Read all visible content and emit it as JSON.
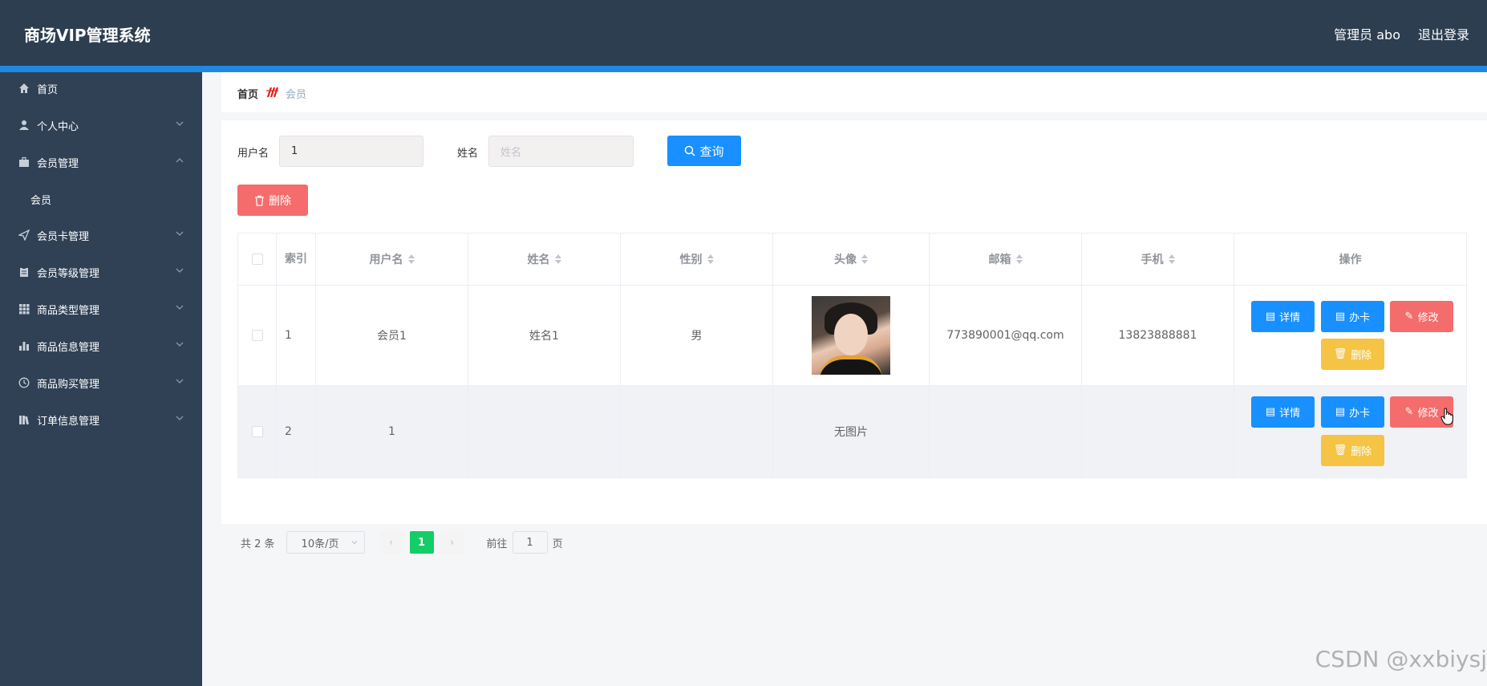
{
  "header": {
    "title": "商场VIP管理系统",
    "user": "管理员 abo",
    "logout": "退出登录"
  },
  "sidebar": {
    "items": [
      {
        "label": "首页",
        "icon": "home-icon"
      },
      {
        "label": "个人中心",
        "icon": "user-icon"
      },
      {
        "label": "会员管理",
        "icon": "briefcase-icon"
      },
      {
        "label": "会员卡管理",
        "icon": "send-icon"
      },
      {
        "label": "会员等级管理",
        "icon": "clipboard-icon"
      },
      {
        "label": "商品类型管理",
        "icon": "grid-icon"
      },
      {
        "label": "商品信息管理",
        "icon": "bar-chart-icon"
      },
      {
        "label": "商品购买管理",
        "icon": "clock-icon"
      },
      {
        "label": "订单信息管理",
        "icon": "books-icon"
      }
    ],
    "sub_item": "会员"
  },
  "breadcrumb": {
    "home": "首页",
    "current": "会员"
  },
  "search": {
    "username_label": "用户名",
    "username_value": "1",
    "name_label": "姓名",
    "name_placeholder": "姓名",
    "query_button": "查询"
  },
  "toolbar": {
    "delete_button": "删除"
  },
  "table": {
    "headers": [
      "索引",
      "用户名",
      "姓名",
      "性别",
      "头像",
      "邮箱",
      "手机",
      "操作"
    ],
    "rows": [
      {
        "index": "1",
        "username": "会员1",
        "name": "姓名1",
        "gender": "男",
        "avatar": "",
        "email": "773890001@qq.com",
        "phone": "13823888881"
      },
      {
        "index": "2",
        "username": "1",
        "name": "",
        "gender": "",
        "avatar": "无图片",
        "email": "",
        "phone": ""
      }
    ],
    "actions": {
      "detail": "详情",
      "card": "办卡",
      "edit": "修改",
      "delete": "删除"
    }
  },
  "pagination": {
    "total": "共 2 条",
    "page_size": "10条/页",
    "current_page": "1",
    "goto_prefix": "前往",
    "goto_value": "1",
    "goto_suffix": "页"
  },
  "watermark": "CSDN @xxbiysj",
  "colors": {
    "header_bg": "#2c3e50",
    "sidebar_bg": "#304156",
    "accent": "#1e88e5",
    "primary": "#1890ff",
    "danger": "#f56c6c",
    "warning": "#f5c445",
    "success": "#13ce66"
  }
}
